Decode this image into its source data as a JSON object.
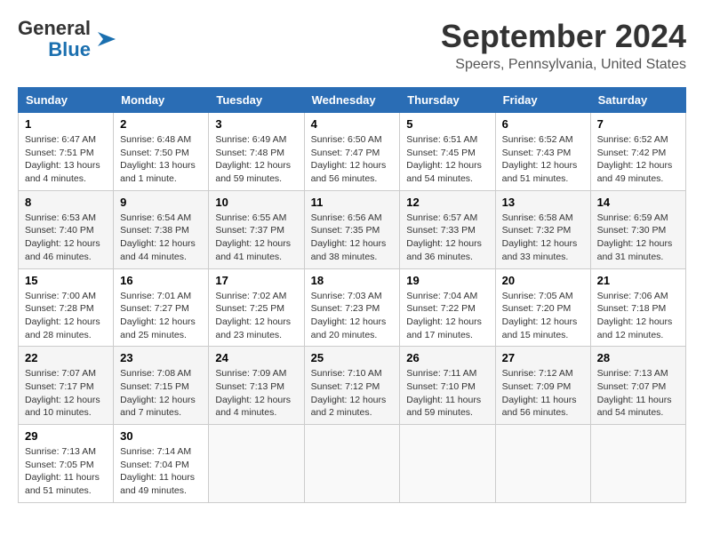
{
  "logo": {
    "line1": "General",
    "line2": "Blue"
  },
  "header": {
    "title": "September 2024",
    "location": "Speers, Pennsylvania, United States"
  },
  "columns": [
    "Sunday",
    "Monday",
    "Tuesday",
    "Wednesday",
    "Thursday",
    "Friday",
    "Saturday"
  ],
  "weeks": [
    [
      {
        "day": "1",
        "info": "Sunrise: 6:47 AM\nSunset: 7:51 PM\nDaylight: 13 hours\nand 4 minutes."
      },
      {
        "day": "2",
        "info": "Sunrise: 6:48 AM\nSunset: 7:50 PM\nDaylight: 13 hours\nand 1 minute."
      },
      {
        "day": "3",
        "info": "Sunrise: 6:49 AM\nSunset: 7:48 PM\nDaylight: 12 hours\nand 59 minutes."
      },
      {
        "day": "4",
        "info": "Sunrise: 6:50 AM\nSunset: 7:47 PM\nDaylight: 12 hours\nand 56 minutes."
      },
      {
        "day": "5",
        "info": "Sunrise: 6:51 AM\nSunset: 7:45 PM\nDaylight: 12 hours\nand 54 minutes."
      },
      {
        "day": "6",
        "info": "Sunrise: 6:52 AM\nSunset: 7:43 PM\nDaylight: 12 hours\nand 51 minutes."
      },
      {
        "day": "7",
        "info": "Sunrise: 6:52 AM\nSunset: 7:42 PM\nDaylight: 12 hours\nand 49 minutes."
      }
    ],
    [
      {
        "day": "8",
        "info": "Sunrise: 6:53 AM\nSunset: 7:40 PM\nDaylight: 12 hours\nand 46 minutes."
      },
      {
        "day": "9",
        "info": "Sunrise: 6:54 AM\nSunset: 7:38 PM\nDaylight: 12 hours\nand 44 minutes."
      },
      {
        "day": "10",
        "info": "Sunrise: 6:55 AM\nSunset: 7:37 PM\nDaylight: 12 hours\nand 41 minutes."
      },
      {
        "day": "11",
        "info": "Sunrise: 6:56 AM\nSunset: 7:35 PM\nDaylight: 12 hours\nand 38 minutes."
      },
      {
        "day": "12",
        "info": "Sunrise: 6:57 AM\nSunset: 7:33 PM\nDaylight: 12 hours\nand 36 minutes."
      },
      {
        "day": "13",
        "info": "Sunrise: 6:58 AM\nSunset: 7:32 PM\nDaylight: 12 hours\nand 33 minutes."
      },
      {
        "day": "14",
        "info": "Sunrise: 6:59 AM\nSunset: 7:30 PM\nDaylight: 12 hours\nand 31 minutes."
      }
    ],
    [
      {
        "day": "15",
        "info": "Sunrise: 7:00 AM\nSunset: 7:28 PM\nDaylight: 12 hours\nand 28 minutes."
      },
      {
        "day": "16",
        "info": "Sunrise: 7:01 AM\nSunset: 7:27 PM\nDaylight: 12 hours\nand 25 minutes."
      },
      {
        "day": "17",
        "info": "Sunrise: 7:02 AM\nSunset: 7:25 PM\nDaylight: 12 hours\nand 23 minutes."
      },
      {
        "day": "18",
        "info": "Sunrise: 7:03 AM\nSunset: 7:23 PM\nDaylight: 12 hours\nand 20 minutes."
      },
      {
        "day": "19",
        "info": "Sunrise: 7:04 AM\nSunset: 7:22 PM\nDaylight: 12 hours\nand 17 minutes."
      },
      {
        "day": "20",
        "info": "Sunrise: 7:05 AM\nSunset: 7:20 PM\nDaylight: 12 hours\nand 15 minutes."
      },
      {
        "day": "21",
        "info": "Sunrise: 7:06 AM\nSunset: 7:18 PM\nDaylight: 12 hours\nand 12 minutes."
      }
    ],
    [
      {
        "day": "22",
        "info": "Sunrise: 7:07 AM\nSunset: 7:17 PM\nDaylight: 12 hours\nand 10 minutes."
      },
      {
        "day": "23",
        "info": "Sunrise: 7:08 AM\nSunset: 7:15 PM\nDaylight: 12 hours\nand 7 minutes."
      },
      {
        "day": "24",
        "info": "Sunrise: 7:09 AM\nSunset: 7:13 PM\nDaylight: 12 hours\nand 4 minutes."
      },
      {
        "day": "25",
        "info": "Sunrise: 7:10 AM\nSunset: 7:12 PM\nDaylight: 12 hours\nand 2 minutes."
      },
      {
        "day": "26",
        "info": "Sunrise: 7:11 AM\nSunset: 7:10 PM\nDaylight: 11 hours\nand 59 minutes."
      },
      {
        "day": "27",
        "info": "Sunrise: 7:12 AM\nSunset: 7:09 PM\nDaylight: 11 hours\nand 56 minutes."
      },
      {
        "day": "28",
        "info": "Sunrise: 7:13 AM\nSunset: 7:07 PM\nDaylight: 11 hours\nand 54 minutes."
      }
    ],
    [
      {
        "day": "29",
        "info": "Sunrise: 7:13 AM\nSunset: 7:05 PM\nDaylight: 11 hours\nand 51 minutes."
      },
      {
        "day": "30",
        "info": "Sunrise: 7:14 AM\nSunset: 7:04 PM\nDaylight: 11 hours\nand 49 minutes."
      },
      null,
      null,
      null,
      null,
      null
    ]
  ]
}
